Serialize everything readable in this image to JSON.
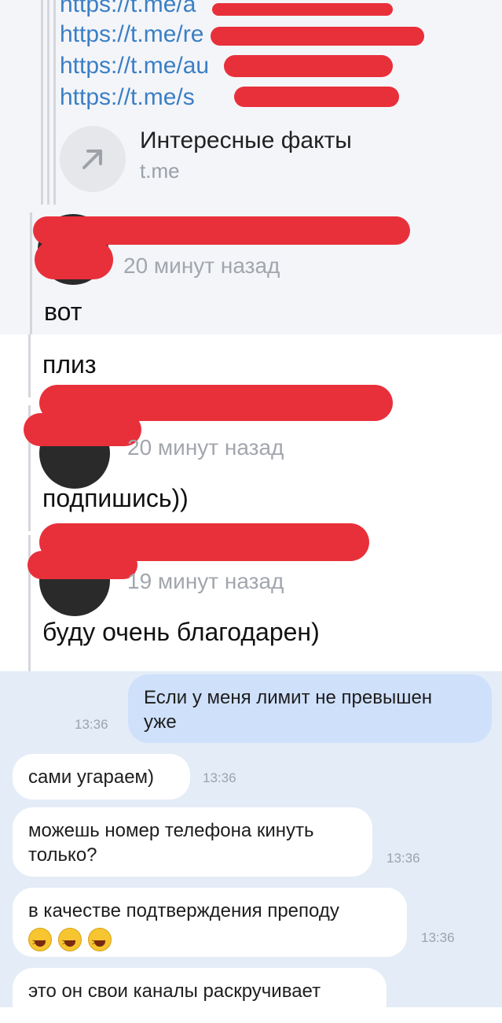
{
  "links": [
    "https://t.me/a",
    "https://t.me/re",
    "https://t.me/au",
    "https://t.me/s"
  ],
  "link_preview": {
    "title": "Интересные факты",
    "host": "t.me",
    "icon": "arrow-up-right-icon"
  },
  "comments": [
    {
      "time": "20 минут назад",
      "texts": [
        "вот",
        "плиз"
      ]
    },
    {
      "time": "20 минут назад",
      "texts": [
        "подпишись))"
      ]
    },
    {
      "time": "19 минут назад",
      "texts": [
        "буду очень благодарен)"
      ]
    }
  ],
  "messages": [
    {
      "direction": "out",
      "lines": [
        "Если у меня лимит не превышен",
        "уже"
      ],
      "time": "13:36"
    },
    {
      "direction": "in",
      "lines": [
        "сами угараем)"
      ],
      "time": "13:36"
    },
    {
      "direction": "in",
      "lines": [
        "можешь номер телефона кинуть",
        "только?"
      ],
      "time": "13:36"
    },
    {
      "direction": "in",
      "lines": [
        "в качестве подтверждения преподу"
      ],
      "emoji_count": 3,
      "emoji": "grinning-squinting-face-emoji",
      "time": "13:36"
    },
    {
      "direction": "in",
      "lines": [
        "это он свои каналы раскручивает"
      ]
    }
  ],
  "colors": {
    "link": "#3b7fc4",
    "redaction": "#e8303b",
    "outgoing_bubble": "#cfe0fb",
    "chat_background": "#e4ecf7"
  }
}
